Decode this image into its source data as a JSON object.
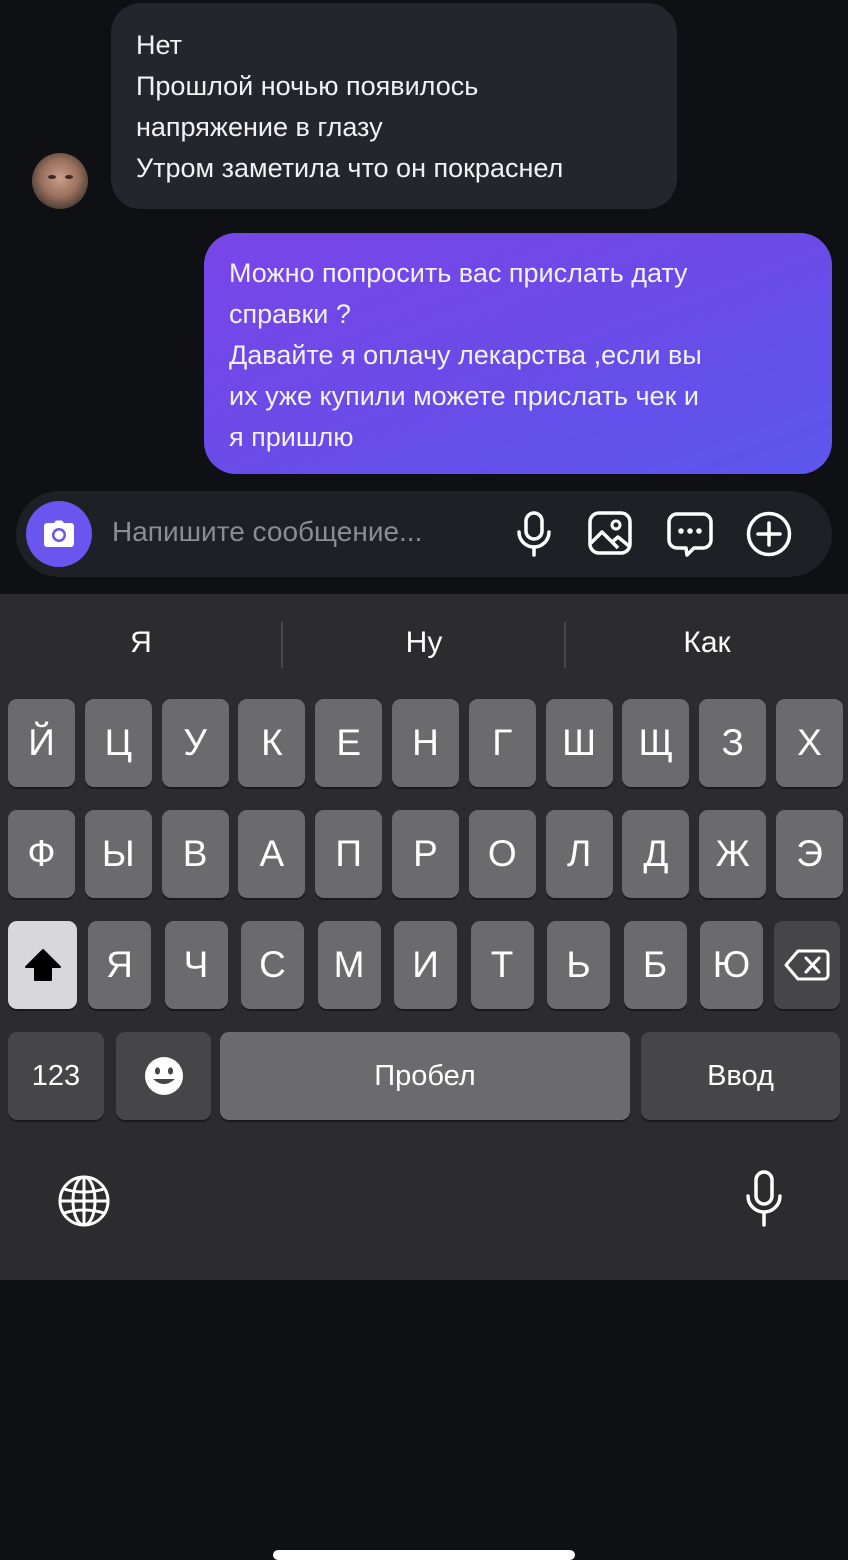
{
  "chat": {
    "incoming": {
      "lines": [
        "Нет",
        "Прошлой ночью появилось",
        "напряжение в глазу",
        "Утром заметила что он покраснел"
      ]
    },
    "outgoing": {
      "lines": [
        "Можно попросить вас прислать дату",
        "справки ?",
        "Давайте я оплачу лекарства ,если вы",
        "их уже купили можете прислать чек и",
        "я пришлю"
      ]
    }
  },
  "composer": {
    "placeholder": "Напишите сообщение...",
    "icons": [
      "camera-icon",
      "microphone-icon",
      "image-icon",
      "chat-bubble-icon",
      "plus-icon"
    ],
    "accent": "#6a55ee"
  },
  "keyboard": {
    "suggestions": [
      "Я",
      "Ну",
      "Как"
    ],
    "row1": [
      "Й",
      "Ц",
      "У",
      "К",
      "Е",
      "Н",
      "Г",
      "Ш",
      "Щ",
      "З",
      "Х"
    ],
    "row2": [
      "Ф",
      "Ы",
      "В",
      "А",
      "П",
      "Р",
      "О",
      "Л",
      "Д",
      "Ж",
      "Э"
    ],
    "row3": [
      "Я",
      "Ч",
      "С",
      "М",
      "И",
      "Т",
      "Ь",
      "Б",
      "Ю"
    ],
    "numbers_label": "123",
    "space_label": "Пробел",
    "return_label": "Ввод",
    "icons": [
      "shift-icon",
      "backspace-icon",
      "emoji-icon",
      "globe-icon",
      "dictation-icon"
    ]
  }
}
